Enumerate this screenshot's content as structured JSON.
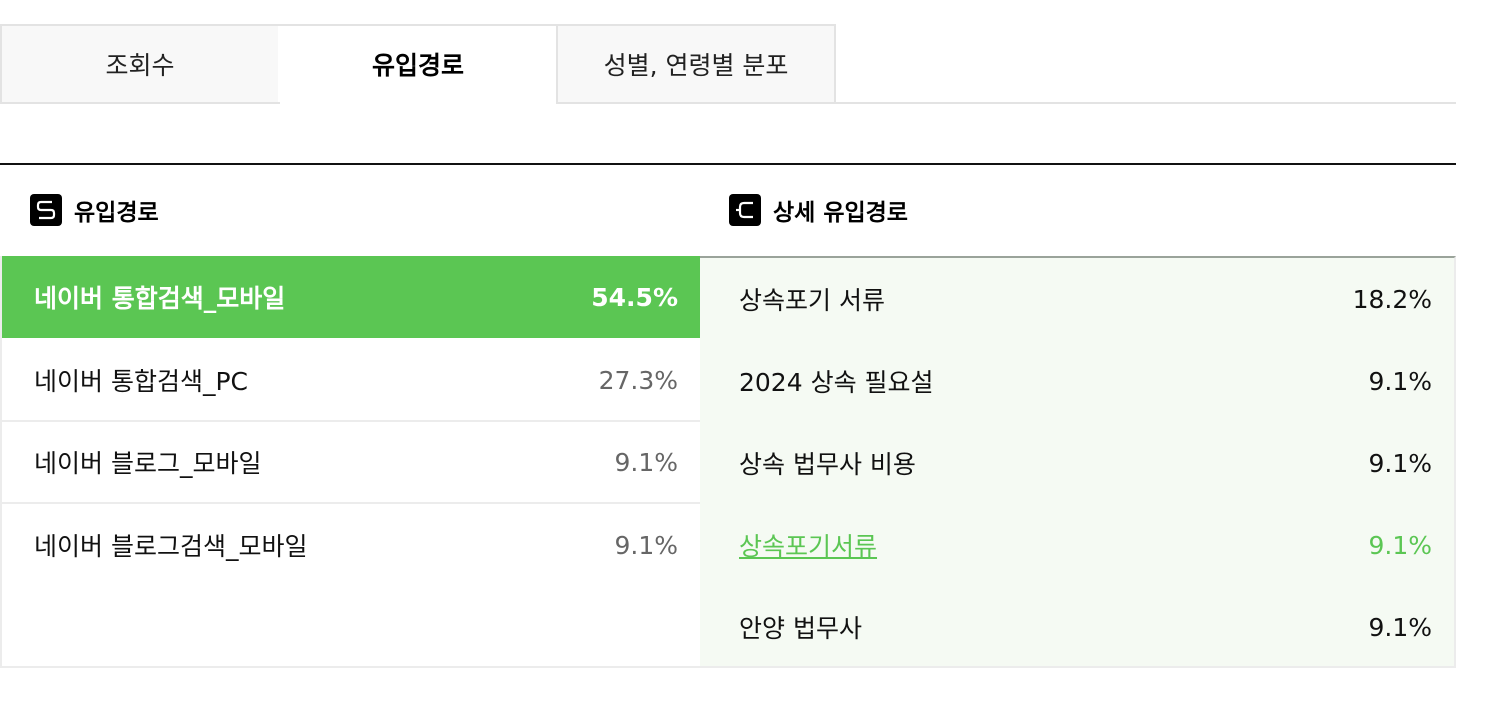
{
  "tabs": [
    {
      "label": "조회수",
      "active": false
    },
    {
      "label": "유입경로",
      "active": true
    },
    {
      "label": "성별, 연령별 분포",
      "active": false
    }
  ],
  "left_section": {
    "title": "유입경로",
    "icon": "s-icon",
    "items": [
      {
        "label": "네이버 통합검색_모바일",
        "percent": "54.5%",
        "selected": true
      },
      {
        "label": "네이버 통합검색_PC",
        "percent": "27.3%",
        "selected": false
      },
      {
        "label": "네이버 블로그_모바일",
        "percent": "9.1%",
        "selected": false
      },
      {
        "label": "네이버 블로그검색_모바일",
        "percent": "9.1%",
        "selected": false
      }
    ]
  },
  "right_section": {
    "title": "상세 유입경로",
    "icon": "c-icon",
    "items": [
      {
        "label": "상속포기 서류",
        "percent": "18.2%",
        "link": false
      },
      {
        "label": "2024 상속 필요설",
        "percent": "9.1%",
        "link": false
      },
      {
        "label": "상속 법무사 비용",
        "percent": "9.1%",
        "link": false
      },
      {
        "label": "상속포기서류",
        "percent": "9.1%",
        "link": true
      },
      {
        "label": "안양 법무사",
        "percent": "9.1%",
        "link": false
      }
    ]
  },
  "colors": {
    "accent": "#5bc653",
    "detail_bg": "#f5faf3"
  }
}
